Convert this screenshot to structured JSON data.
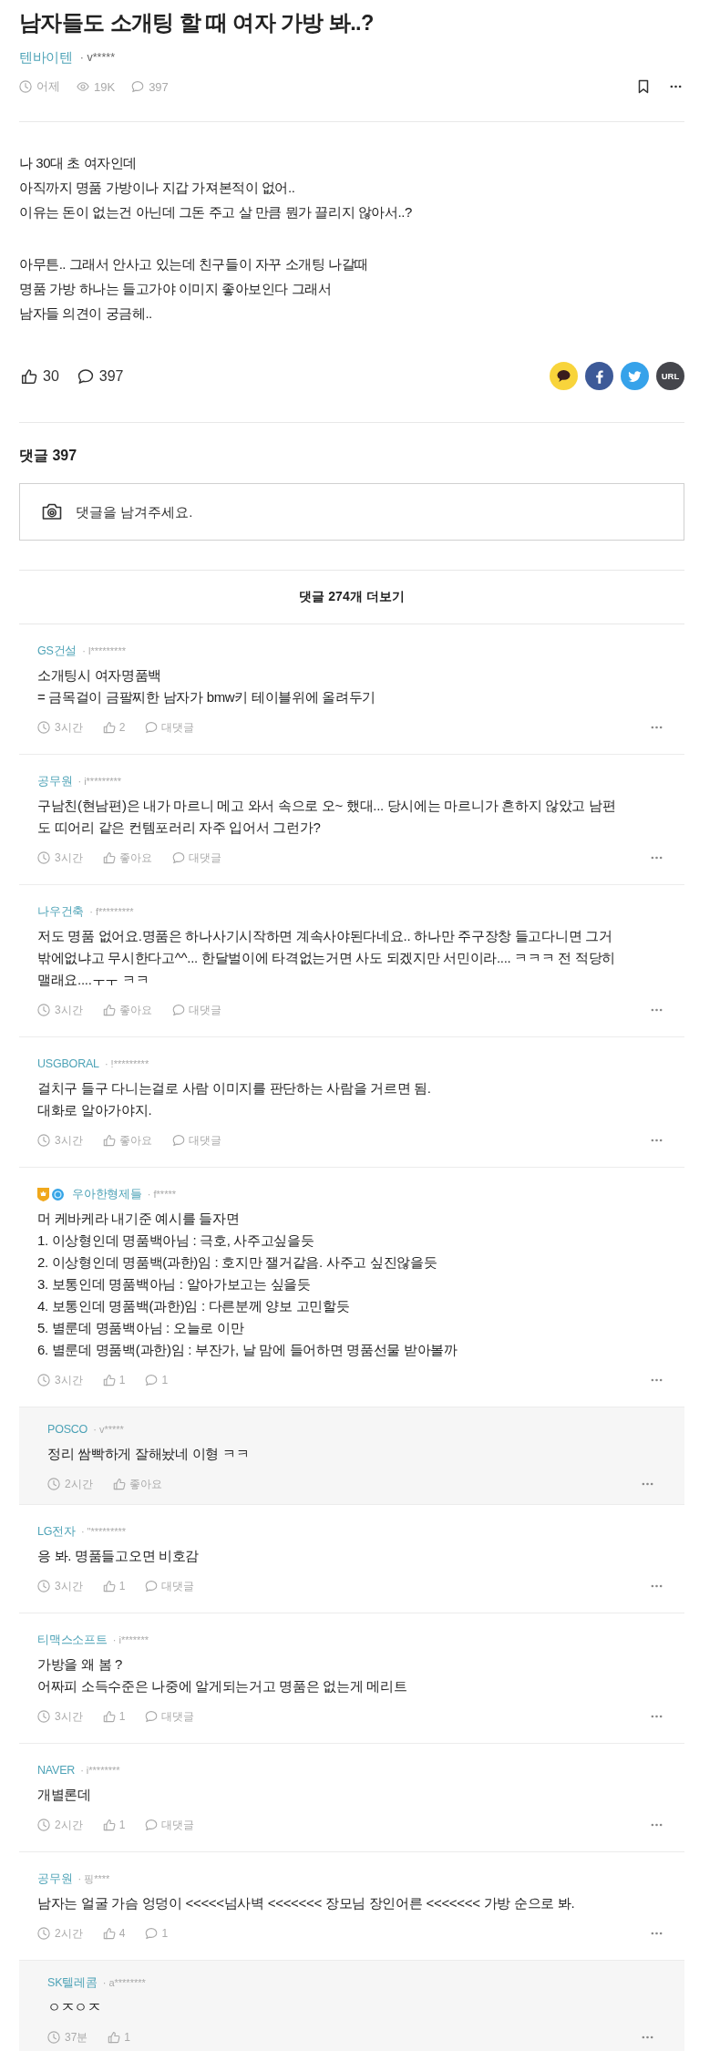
{
  "post": {
    "title": "남자들도 소개팅 할 때 여자 가방 봐..?",
    "company": "텐바이텐",
    "author": "· v*****",
    "time": "어제",
    "views": "19K",
    "comment_count": "397",
    "paragraphs": [
      "나 30대 초 여자인데\n아직까지 명품 가방이나 지갑 가져본적이 없어..\n이유는 돈이 없는건 아닌데 그돈 주고 살 만큼 뭔가 끌리지 않아서..?",
      "아무튼.. 그래서 안사고 있는데 친구들이 자꾸 소개팅 나갈때\n명품 가방 하나는 들고가야 이미지 좋아보인다 그래서\n남자들 의견이 궁금헤.."
    ],
    "likes": "30",
    "comments": "397"
  },
  "share": [
    {
      "kind": "kakao"
    },
    {
      "kind": "facebook"
    },
    {
      "kind": "twitter"
    },
    {
      "kind": "url",
      "label": "URL"
    }
  ],
  "comment_section": {
    "heading": "댓글 397",
    "placeholder": "댓글을 남겨주세요.",
    "more": "댓글 274개 더보기"
  },
  "comments": [
    {
      "kind": "comment",
      "company": "GS건설",
      "author": "· l*********",
      "text": "소개팅시 여자명품백\n= 금목걸이 금팔찌한 남자가 bmw키 테이블위에 올려두기",
      "time": "3시간",
      "likes": "2",
      "replies": "대댓글"
    },
    {
      "kind": "comment",
      "company": "공무원",
      "author": "· i*********",
      "text": "구남친(현남편)은 내가 마르니 메고 와서 속으로 오~ 했대... 당시에는 마르니가 흔하지 않았고 남편도 띠어리 같은 컨템포러리 자주 입어서 그런가?",
      "time": "3시간",
      "likes": "좋아요",
      "replies": "대댓글"
    },
    {
      "kind": "comment",
      "company": "나우건축",
      "author": "· f*********",
      "text": "저도 명품 없어요.명품은 하나사기시작하면 계속사야된다네요.. 하나만 주구장창 들고다니면 그거 밖에없냐고 무시한다고^^... 한달벌이에 타격없는거면 사도 되겠지만 서민이라.... ㅋㅋㅋ 전 적당히 맬래요....ㅜㅜ ㅋㅋ",
      "time": "3시간",
      "likes": "좋아요",
      "replies": "대댓글"
    },
    {
      "kind": "comment",
      "company": "USGBORAL",
      "author": "· !*********",
      "text": "걸치구 들구 다니는걸로 사람 이미지를 판단하는 사람을 거르면 됨.\n대화로 알아가야지.",
      "time": "3시간",
      "likes": "좋아요",
      "replies": "대댓글"
    },
    {
      "kind": "comment",
      "badges": [
        {
          "kind": "shield"
        },
        {
          "kind": "round"
        }
      ],
      "company": "우아한형제들",
      "author": "· f*****",
      "text": "머 케바케라 내기준 예시를 들자면\n1. 이상형인데 명품백아님 : 극호, 사주고싶을듯\n2. 이상형인데 명품백(과한)임 : 호지만 잴거같음. 사주고 싶진않을듯\n3. 보통인데 명품백아님 : 알아가보고는 싶을듯\n4. 보통인데 명품백(과한)임 : 다른분께 양보 고민할듯\n5. 별룬데 명품백아님 : 오늘로 이만\n6. 별룬데 명품백(과한)임 : 부잔가, 날 맘에 들어하면 명품선물 받아볼까",
      "time": "3시간",
      "likes": "1",
      "replies": "1"
    },
    {
      "kind": "reply",
      "company": "POSCO",
      "author": "· v*****",
      "text": "정리 쌈빡하게 잘해놨네 이형 ㅋㅋ",
      "time": "2시간",
      "likes": "좋아요"
    },
    {
      "kind": "comment",
      "company": "LG전자",
      "author": "· \"*********",
      "text": "응 봐. 명품들고오면 비호감",
      "time": "3시간",
      "likes": "1",
      "replies": "대댓글"
    },
    {
      "kind": "comment",
      "company": "티맥스소프트",
      "author": "· i*******",
      "text": "가방을 왜 봄 ?\n어짜피 소득수준은 나중에 알게되는거고 명품은 없는게 메리트",
      "time": "3시간",
      "likes": "1",
      "replies": "대댓글"
    },
    {
      "kind": "comment",
      "company": "NAVER",
      "author": "· i********",
      "text": "개별론데",
      "time": "2시간",
      "likes": "1",
      "replies": "대댓글"
    },
    {
      "kind": "comment",
      "company": "공무원",
      "author": "· 핑****",
      "text": "남자는 얼굴 가슴 엉덩이 <<<<<넘사벽 <<<<<<< 장모님 장인어른 <<<<<<< 가방 순으로 봐.",
      "time": "2시간",
      "likes": "4",
      "replies": "1"
    },
    {
      "kind": "reply",
      "company": "SK텔레콤",
      "author": "· a********",
      "text": "ㅇㅈㅇㅈ",
      "time": "37분",
      "likes": "1"
    }
  ]
}
